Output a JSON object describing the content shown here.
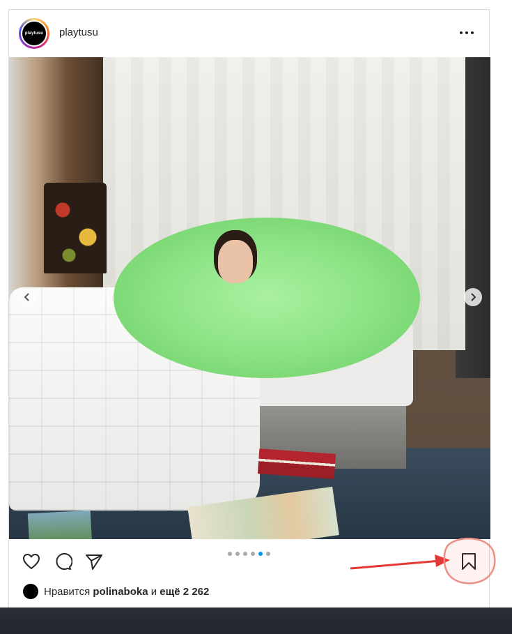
{
  "post": {
    "username": "playtusu",
    "avatar_text": "playtusu",
    "more_icon": "more-horizontal-icon",
    "carousel": {
      "total": 6,
      "active_index": 4
    },
    "actions": {
      "like_icon": "heart-icon",
      "comment_icon": "comment-icon",
      "share_icon": "send-icon",
      "save_icon": "bookmark-icon"
    },
    "likes": {
      "prefix": "Нравится",
      "user": "polinaboka",
      "conj": "и",
      "count_text": "ещё 2 262"
    }
  },
  "annotation": {
    "color": "#e53935",
    "target": "save-button"
  }
}
